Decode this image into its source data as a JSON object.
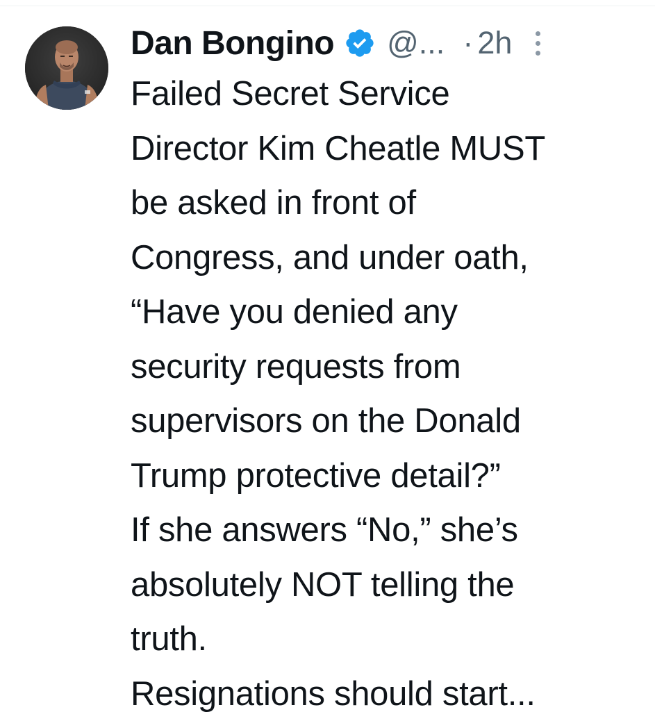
{
  "tweet": {
    "author": {
      "display_name": "Dan Bongino",
      "handle": "@...",
      "verified": true,
      "avatar_icon": "profile-photo"
    },
    "separator": "·",
    "time": "2h",
    "more_icon": "more-vertical-icon",
    "lines": [
      "Failed Secret Service",
      "Director Kim Cheatle MUST",
      "be asked in front of",
      "Congress, and under oath,",
      "“Have you denied any",
      "security requests from",
      "supervisors on the Donald",
      "Trump protective detail?”",
      "If she answers “No,” she’s",
      "absolutely NOT telling the",
      "truth.",
      "Resignations should start..."
    ]
  },
  "colors": {
    "text_primary": "#0f1419",
    "text_secondary": "#536471",
    "verified_blue": "#1d9bf0",
    "background": "#ffffff"
  }
}
